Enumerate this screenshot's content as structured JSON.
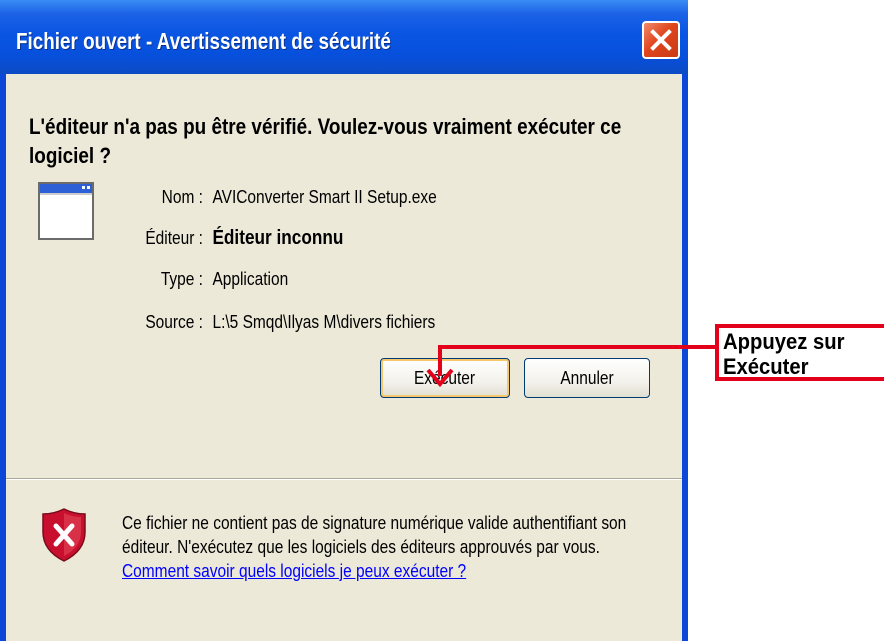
{
  "window": {
    "title": "Fichier ouvert - Avertissement de sécurité",
    "close_icon": "close-x-icon"
  },
  "dialog": {
    "headline": "L'éditeur n'a pas pu être vérifié. Voulez-vous vraiment exécuter ce logiciel ?",
    "app_icon": "application-window-icon",
    "fields": {
      "name_label": "Nom :",
      "name_value": "AVIConverter Smart II Setup.exe",
      "publisher_label": "Éditeur :",
      "publisher_value": "Éditeur inconnu",
      "type_label": "Type :",
      "type_value": "Application",
      "source_label": "Source :",
      "source_value": "L:\\5 Smqd\\Ilyas M\\divers fichiers"
    },
    "buttons": {
      "run": "Exécuter",
      "cancel": "Annuler"
    },
    "warning": {
      "icon": "security-shield-icon",
      "text": "Ce fichier ne contient pas de signature numérique valide authentifiant son éditeur. N'exécutez que les logiciels des éditeurs approuvés par vous.",
      "link": "Comment savoir quels logiciels je peux exécuter ?"
    }
  },
  "annotation": {
    "line1": "Appuyez sur",
    "line2": "Exécuter",
    "color": "#e2001a"
  },
  "colors": {
    "titlebar": "#0a55e3",
    "client_bg": "#ece9d8",
    "close_button": "#e0461e",
    "link": "#0000ff"
  }
}
